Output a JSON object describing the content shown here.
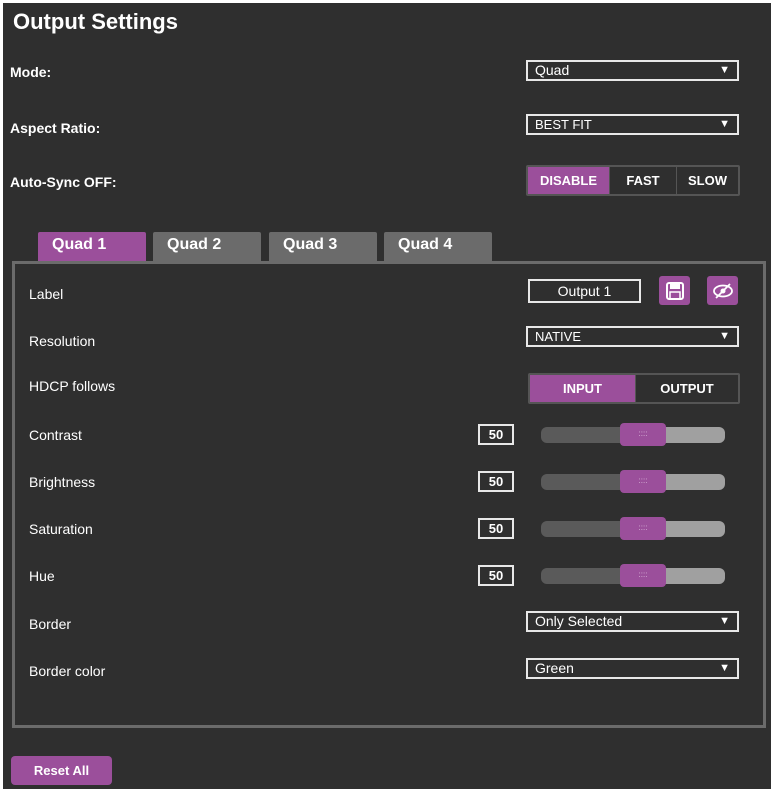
{
  "title": "Output Settings",
  "mode": {
    "label": "Mode:",
    "value": "Quad"
  },
  "aspect_ratio": {
    "label": "Aspect Ratio:",
    "value": "BEST FIT"
  },
  "auto_sync": {
    "label": "Auto-Sync OFF:",
    "options": [
      "DISABLE",
      "FAST",
      "SLOW"
    ],
    "selected": "DISABLE"
  },
  "tabs": [
    {
      "label": "Quad 1",
      "active": true
    },
    {
      "label": "Quad 2",
      "active": false
    },
    {
      "label": "Quad 3",
      "active": false
    },
    {
      "label": "Quad 4",
      "active": false
    }
  ],
  "quad": {
    "label_field": {
      "label": "Label",
      "value": "Output  1"
    },
    "resolution": {
      "label": "Resolution",
      "value": "NATIVE"
    },
    "hdcp": {
      "label": "HDCP follows",
      "options": [
        "INPUT",
        "OUTPUT"
      ],
      "selected": "INPUT"
    },
    "contrast": {
      "label": "Contrast",
      "value": "50",
      "level": 0.5
    },
    "brightness": {
      "label": "Brightness",
      "value": "50",
      "level": 0.5
    },
    "saturation": {
      "label": "Saturation",
      "value": "50",
      "level": 0.5
    },
    "hue": {
      "label": "Hue",
      "value": "50",
      "level": 0.5
    },
    "border": {
      "label": "Border",
      "value": "Only Selected"
    },
    "border_color": {
      "label": "Border color",
      "value": "Green"
    }
  },
  "reset_label": "Reset All",
  "icons": {
    "dropdown": "chevron-down-icon",
    "save": "save-icon",
    "hide": "eye-off-icon",
    "grip": "grip-icon"
  },
  "colors": {
    "accent": "#9b4f9b",
    "background": "#2f2f2f",
    "tab_inactive": "#6b6b6b"
  }
}
